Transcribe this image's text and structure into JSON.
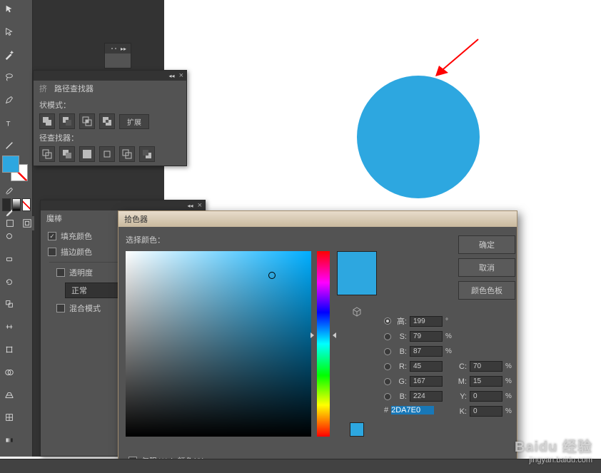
{
  "pathfinder": {
    "tab": "路径查找器",
    "leftTab": "挤",
    "shapeMode": "状模式：",
    "expand": "扩展",
    "pathfinderLabel": "径查找器："
  },
  "wand": {
    "tab": "魔棒",
    "fillColor": "填充颜色",
    "strokeColor": "描边颜色",
    "transparency": "透明度",
    "normal": "正常",
    "blendMode": "混合模式"
  },
  "picker": {
    "title": "拾色器",
    "selectColor": "选择颜色：",
    "ok": "确定",
    "cancel": "取消",
    "swatches": "颜色色板",
    "webOnly": "仅限 Web 颜色(O)",
    "h": {
      "label": "高:",
      "value": "199",
      "unit": "°"
    },
    "s": {
      "label": "S:",
      "value": "79",
      "unit": "%"
    },
    "b": {
      "label": "B:",
      "value": "87",
      "unit": "%"
    },
    "r": {
      "label": "R:",
      "value": "45"
    },
    "g": {
      "label": "G:",
      "value": "167"
    },
    "bl": {
      "label": "B:",
      "value": "224"
    },
    "c": {
      "label": "C:",
      "value": "70",
      "unit": "%"
    },
    "m": {
      "label": "M:",
      "value": "15",
      "unit": "%"
    },
    "y": {
      "label": "Y:",
      "value": "0",
      "unit": "%"
    },
    "k": {
      "label": "K:",
      "value": "0",
      "unit": "%"
    },
    "hex": {
      "label": "#",
      "value": "2DA7E0"
    }
  },
  "watermark": {
    "logo": "Baidu 经验",
    "url": "jingyan.baidu.com"
  }
}
